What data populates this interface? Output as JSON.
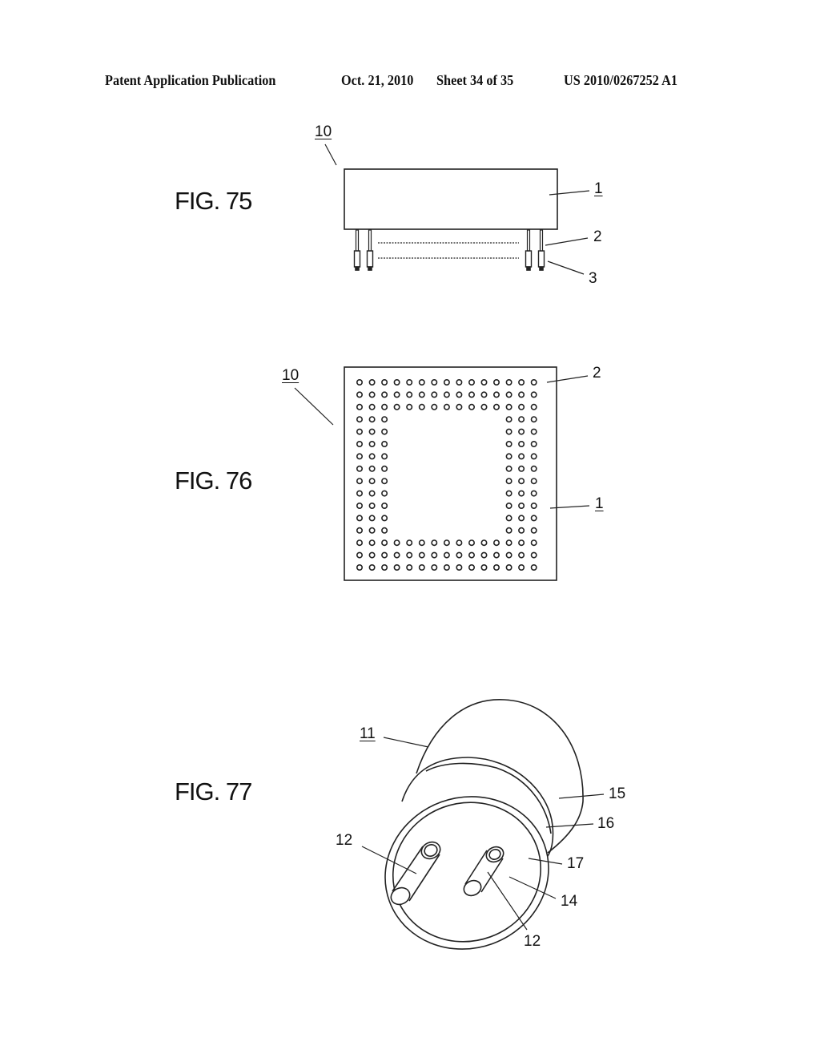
{
  "header": {
    "publication": "Patent Application Publication",
    "date": "Oct. 21, 2010",
    "sheet": "Sheet 34 of 35",
    "number": "US 2010/0267252 A1"
  },
  "figures": [
    {
      "label": "FIG. 75",
      "description": "Side view of package with pins",
      "refs": {
        "assembly": "10",
        "body": "1",
        "pin": "2",
        "pin_tip": "3"
      }
    },
    {
      "label": "FIG. 76",
      "description": "Bottom view of package with pin grid array",
      "pin_grid": {
        "columns": 15,
        "rows": 16,
        "perimeter_depth": 3
      },
      "refs": {
        "assembly": "10",
        "pin": "2",
        "body": "1"
      }
    },
    {
      "label": "FIG. 77",
      "description": "Perspective view of cylindrical cap with two pins",
      "refs": {
        "assembly": "11",
        "pin_left": "12",
        "pin_right": "12",
        "face": "14",
        "cylinder": "15",
        "ring_outer": "16",
        "ring_inner": "17"
      }
    }
  ]
}
